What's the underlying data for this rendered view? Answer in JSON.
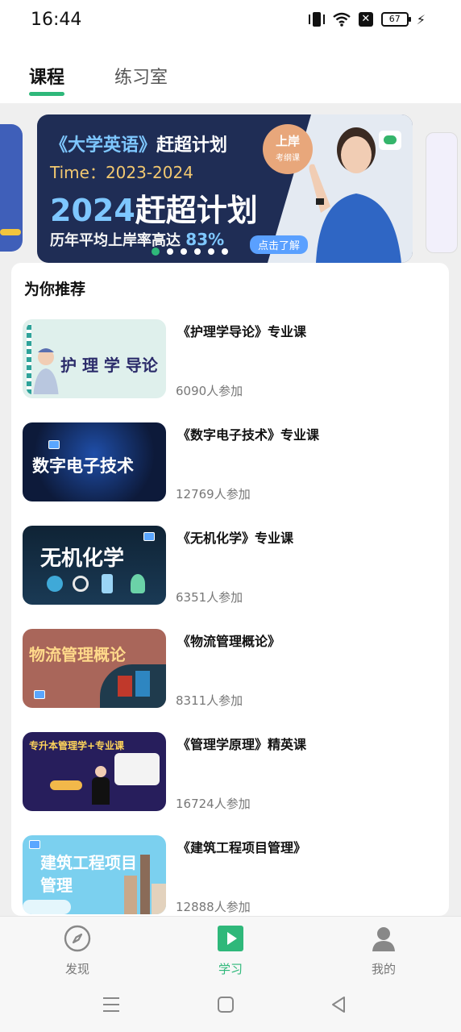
{
  "status_bar": {
    "time": "16:44",
    "battery": "67"
  },
  "tabs": [
    {
      "label": "课程",
      "active": true
    },
    {
      "label": "练习室",
      "active": false
    }
  ],
  "banner": {
    "title_highlight": "《大学英语》",
    "title_rest": "赶超计划",
    "time_line": "Time：2023-2024",
    "big_year": "2024",
    "big_rest": "赶超计划",
    "rate_text": "历年平均上岸率高达",
    "rate_value": "83%",
    "badge_main": "上岸",
    "badge_sub": "考纲课",
    "cta": "点击了解",
    "dots": 6,
    "active_dot": 0
  },
  "recommend": {
    "title": "为你推荐",
    "courses": [
      {
        "title": "《护理学导论》专业课",
        "count": "6090人参加",
        "thumb_text": "护 理 学 导论",
        "thumb_color": "#dff0ec"
      },
      {
        "title": "《数字电子技术》专业课",
        "count": "12769人参加",
        "thumb_text": "数字电子技术",
        "thumb_color": "#0d1a3a"
      },
      {
        "title": "《无机化学》专业课",
        "count": "6351人参加",
        "thumb_text": "无机化学",
        "thumb_color": "#0f2335"
      },
      {
        "title": "《物流管理概论》",
        "count": "8311人参加",
        "thumb_text": "物流管理概论",
        "thumb_color": "#a9665a"
      },
      {
        "title": "《管理学原理》精英课",
        "count": "16724人参加",
        "thumb_text": "专升本管理学+专业课",
        "thumb_color": "#271e5c"
      },
      {
        "title": "《建筑工程项目管理》",
        "count": "12888人参加",
        "thumb_text": "建筑工程项目管理",
        "thumb_color": "#7bd0ef"
      }
    ]
  },
  "bottom_nav": [
    {
      "label": "发现",
      "icon": "compass-icon"
    },
    {
      "label": "学习",
      "icon": "play-icon",
      "active": true
    },
    {
      "label": "我的",
      "icon": "person-icon"
    }
  ],
  "colors": {
    "accent": "#2fb87a"
  }
}
